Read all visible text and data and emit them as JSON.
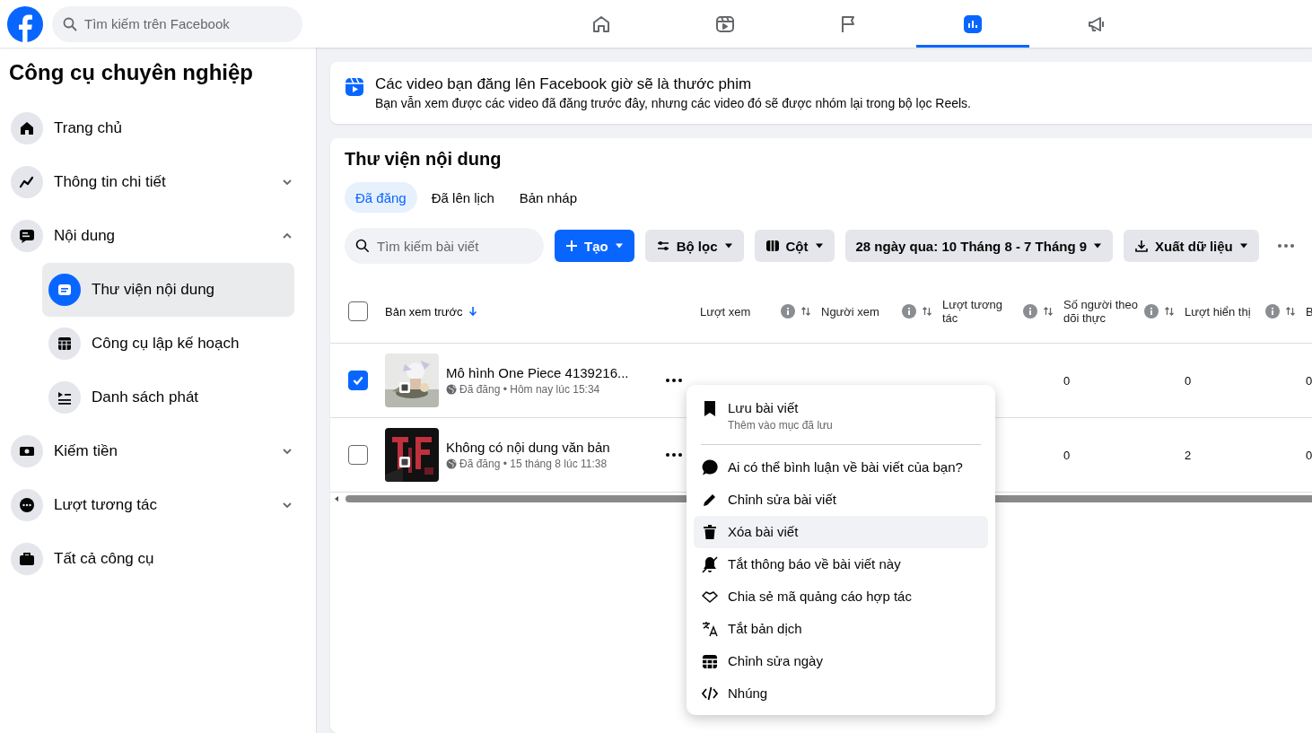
{
  "header": {
    "search": {
      "placeholder": "Tìm kiếm trên Facebook"
    },
    "nav": [
      {
        "selected": false
      },
      {
        "selected": false
      },
      {
        "selected": false
      },
      {
        "selected": true
      },
      {
        "selected": false
      }
    ]
  },
  "sidebar": {
    "title": "Công cụ chuyên nghiệp",
    "items": [
      {
        "label": "Trang chủ",
        "kind": "link"
      },
      {
        "label": "Thông tin chi tiết",
        "kind": "group",
        "expanded": false
      },
      {
        "label": "Nội dung",
        "kind": "group",
        "expanded": true,
        "children": [
          {
            "label": "Thư viện nội dung",
            "selected": true
          },
          {
            "label": "Công cụ lập kế hoạch",
            "selected": false
          },
          {
            "label": "Danh sách phát",
            "selected": false
          }
        ]
      },
      {
        "label": "Kiếm tiền",
        "kind": "group",
        "expanded": false
      },
      {
        "label": "Lượt tương tác",
        "kind": "group",
        "expanded": false
      },
      {
        "label": "Tất cả công cụ",
        "kind": "link"
      }
    ]
  },
  "banner": {
    "title": "Các video bạn đăng lên Facebook giờ sẽ là thước phim",
    "text": "Bạn vẫn xem được các video đã đăng trước đây, nhưng các video đó sẽ được nhóm lại trong bộ lọc Reels."
  },
  "library": {
    "title": "Thư viện nội dung",
    "tabs": [
      {
        "label": "Đã đăng",
        "selected": true
      },
      {
        "label": "Đã lên lịch",
        "selected": false
      },
      {
        "label": "Bản nháp",
        "selected": false
      }
    ],
    "search": {
      "placeholder": "Tìm kiếm bài viết"
    },
    "create_button": "Tạo",
    "filter_button": "Bộ lọc",
    "columns_button": "Cột",
    "date_range": "28 ngày qua: 10 Tháng 8 - 7 Tháng 9",
    "export_button": "Xuất dữ liệu",
    "table": {
      "all_checked": false,
      "columns": [
        {
          "label": "Bản xem trước",
          "kind": "preview",
          "sorted": true
        },
        {
          "label": "Lượt xem",
          "kind": "metric",
          "sorted": false
        },
        {
          "label": "Người xem",
          "kind": "metric",
          "sorted": false
        },
        {
          "label": "Lượt tương tác",
          "kind": "metric",
          "sorted": false
        },
        {
          "label": "Số người theo dõi thực",
          "kind": "metric",
          "sorted": false
        },
        {
          "label": "Lượt hiển thị",
          "kind": "metric",
          "sorted": false
        },
        {
          "label": "B",
          "kind": "partial"
        }
      ],
      "rows": [
        {
          "checked": true,
          "title": "Mô hình One Piece 4139216...",
          "meta": "Đã đăng • Hôm nay lúc 15:34",
          "followers": "0",
          "impressions": "0",
          "column_7": "0"
        },
        {
          "checked": false,
          "title": "Không có nội dung văn bản",
          "meta": "Đã đăng • 15 tháng 8 lúc 11:38",
          "followers": "0",
          "impressions": "2",
          "column_7": "0"
        }
      ]
    }
  },
  "menu": {
    "sections": [
      [
        {
          "label": "Lưu bài viết",
          "sublabel": "Thêm vào mục đã lưu",
          "highlighted": false
        }
      ],
      [
        {
          "label": "Ai có thể bình luận về bài viết của bạn?",
          "highlighted": false
        },
        {
          "label": "Chỉnh sửa bài viết",
          "highlighted": false
        },
        {
          "label": "Xóa bài viết",
          "highlighted": true
        },
        {
          "label": "Tắt thông báo về bài viết này",
          "highlighted": false
        },
        {
          "label": "Chia sẻ mã quảng cáo hợp tác",
          "highlighted": false
        },
        {
          "label": "Tắt bản dịch",
          "highlighted": false
        },
        {
          "label": "Chỉnh sửa ngày",
          "highlighted": false
        },
        {
          "label": "Nhúng",
          "highlighted": false
        }
      ]
    ]
  }
}
